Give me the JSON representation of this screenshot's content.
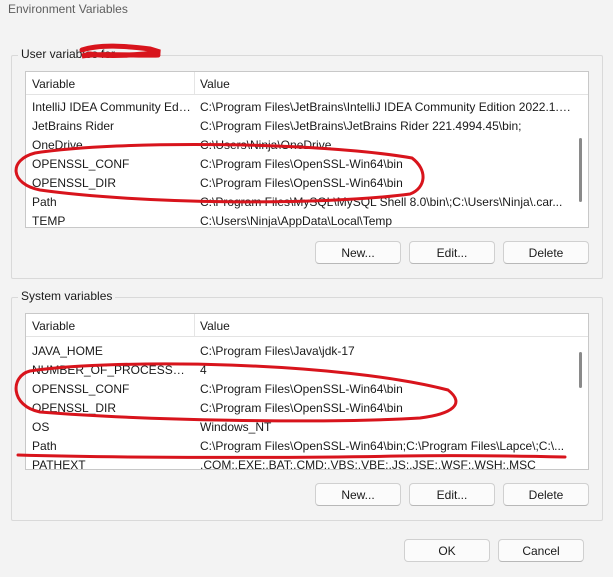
{
  "window": {
    "title": "Environment Variables"
  },
  "user_group": {
    "label": "User variables for",
    "columns": [
      "Variable",
      "Value"
    ],
    "rows": [
      {
        "variable": "IntelliJ IDEA Community Edit...",
        "value": "C:\\Program Files\\JetBrains\\IntelliJ IDEA Community Edition 2022.1.2..."
      },
      {
        "variable": "JetBrains Rider",
        "value": "C:\\Program Files\\JetBrains\\JetBrains Rider 221.4994.45\\bin;"
      },
      {
        "variable": "OneDrive",
        "value": "C:\\Users\\Ninja\\OneDrive"
      },
      {
        "variable": "OPENSSL_CONF",
        "value": "C:\\Program Files\\OpenSSL-Win64\\bin"
      },
      {
        "variable": "OPENSSL_DIR",
        "value": "C:\\Program Files\\OpenSSL-Win64\\bin"
      },
      {
        "variable": "Path",
        "value": "C:\\Program Files\\MySQL\\MySQL Shell 8.0\\bin\\;C:\\Users\\Ninja\\.car..."
      },
      {
        "variable": "TEMP",
        "value": "C:\\Users\\Ninja\\AppData\\Local\\Temp"
      }
    ],
    "buttons": {
      "new": "New...",
      "edit": "Edit...",
      "delete": "Delete"
    }
  },
  "system_group": {
    "label": "System variables",
    "columns": [
      "Variable",
      "Value"
    ],
    "rows": [
      {
        "variable": "JAVA_HOME",
        "value": "C:\\Program Files\\Java\\jdk-17"
      },
      {
        "variable": "NUMBER_OF_PROCESSORS",
        "value": "4"
      },
      {
        "variable": "OPENSSL_CONF",
        "value": "C:\\Program Files\\OpenSSL-Win64\\bin"
      },
      {
        "variable": "OPENSSL_DIR",
        "value": "C:\\Program Files\\OpenSSL-Win64\\bin"
      },
      {
        "variable": "OS",
        "value": "Windows_NT"
      },
      {
        "variable": "Path",
        "value": "C:\\Program Files\\OpenSSL-Win64\\bin;C:\\Program Files\\Lapce\\;C:\\..."
      },
      {
        "variable": "PATHEXT",
        "value": ".COM;.EXE;.BAT;.CMD;.VBS;.VBE;.JS;.JSE;.WSF;.WSH;.MSC"
      }
    ],
    "buttons": {
      "new": "New...",
      "edit": "Edit...",
      "delete": "Delete"
    }
  },
  "footer": {
    "ok": "OK",
    "cancel": "Cancel"
  },
  "colors": {
    "annotation": "#d8141c",
    "window_bg": "#f3f3f3",
    "list_bg": "#ffffff"
  }
}
